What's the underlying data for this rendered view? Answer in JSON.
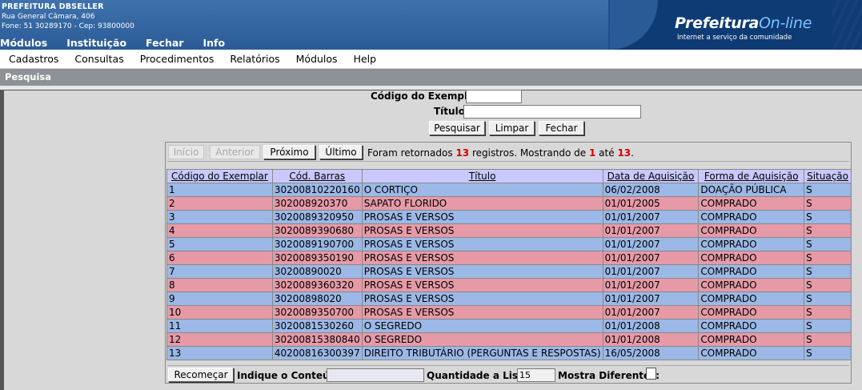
{
  "header": {
    "org_name": "PREFEITURA DBSELLER",
    "address": "Rua General Câmara, 406",
    "phone": "Fone: 51 30289170  -  Cep: 93800000",
    "top_menu": [
      "Módulos",
      "Instituição",
      "Fechar",
      "Info"
    ],
    "logo_main": "Prefeitura",
    "logo_online": "On-line",
    "logo_tagline": "Internet a serviço da comunidade"
  },
  "menu": [
    "Cadastros",
    "Consultas",
    "Procedimentos",
    "Relatórios",
    "Módulos",
    "Help"
  ],
  "title_bar": "Pesquisa",
  "form": {
    "codigo_label": "Código do Exemplar:",
    "codigo_value": "",
    "titulo_label": "Título:",
    "titulo_value": "",
    "btn_pesquisar": "Pesquisar",
    "btn_limpar": "Limpar",
    "btn_fechar": "Fechar"
  },
  "nav": {
    "inicio": "Início",
    "anterior": "Anterior",
    "proximo": "Próximo",
    "ultimo": "Último",
    "msg_prefix": "Foram retornados",
    "total": "13",
    "msg_mid": "registros. Mostrando de",
    "from": "1",
    "msg_ate": "até",
    "to": "13",
    "msg_end": "."
  },
  "table": {
    "columns": [
      "Código do Exemplar",
      "Cód. Barras",
      "Título",
      "Data de Aquisição",
      "Forma de Aquisição",
      "Situação"
    ],
    "rows": [
      [
        "1",
        "30200810220160",
        "O CORTIÇO",
        "06/02/2008",
        "DOAÇÃO PÚBLICA",
        "S"
      ],
      [
        "2",
        "302008920370",
        "SAPATO FLORIDO",
        "01/01/2005",
        "COMPRADO",
        "S"
      ],
      [
        "3",
        "3020089320950",
        "PROSAS E VERSOS",
        "01/01/2007",
        "COMPRADO",
        "S"
      ],
      [
        "4",
        "3020089390680",
        "PROSAS E VERSOS",
        "01/01/2007",
        "COMPRADO",
        "S"
      ],
      [
        "5",
        "3020089190700",
        "PROSAS E VERSOS",
        "01/01/2007",
        "COMPRADO",
        "S"
      ],
      [
        "6",
        "3020089350190",
        "PROSAS E VERSOS",
        "01/01/2007",
        "COMPRADO",
        "S"
      ],
      [
        "7",
        "30200890020",
        "PROSAS E VERSOS",
        "01/01/2007",
        "COMPRADO",
        "S"
      ],
      [
        "8",
        "3020089360320",
        "PROSAS E VERSOS",
        "01/01/2007",
        "COMPRADO",
        "S"
      ],
      [
        "9",
        "30200898020",
        "PROSAS E VERSOS",
        "01/01/2007",
        "COMPRADO",
        "S"
      ],
      [
        "10",
        "3020089350700",
        "PROSAS E VERSOS",
        "01/01/2007",
        "COMPRADO",
        "S"
      ],
      [
        "11",
        "3020081530260",
        "O SEGREDO",
        "01/01/2008",
        "COMPRADO",
        "S"
      ],
      [
        "12",
        "30200815380840",
        "O SEGREDO",
        "01/01/2008",
        "COMPRADO",
        "S"
      ],
      [
        "13",
        "40200816300397",
        "DIREITO TRIBUTÁRIO (PERGUNTAS E RESPOSTAS)",
        "16/05/2008",
        "COMPRADO",
        "S"
      ]
    ]
  },
  "bottom": {
    "btn_recomecar": "Recomeçar",
    "conteudo_label": "Indique o Conteúdo:",
    "conteudo_value": "",
    "quantidade_label": "Quantidade a Listar:",
    "quantidade_value": "15",
    "diferentes_label": "Mostra Diferentes:"
  },
  "colors": {
    "row_odd": "#9bb8e6",
    "row_even": "#e69aa7",
    "header_row": "#c9c9ff",
    "highlight": "#d80000"
  }
}
